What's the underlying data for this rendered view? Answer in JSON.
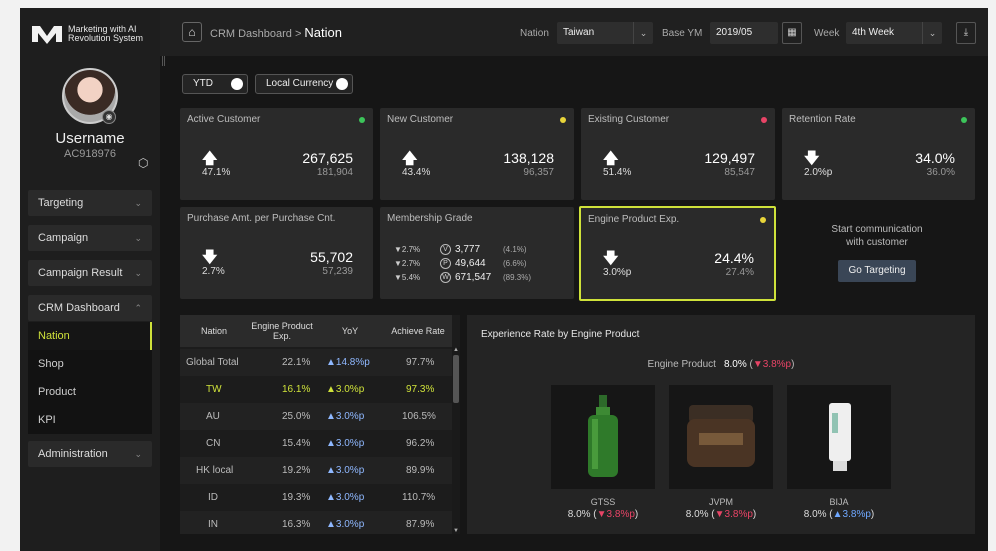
{
  "app": {
    "logo_line1": "Marketing with AI",
    "logo_line2": "Revolution System",
    "logo_mark_text": "MARS"
  },
  "user": {
    "name": "Username",
    "id": "AC918976"
  },
  "sidebar": {
    "menus": [
      {
        "label": "Targeting",
        "chev": "⌄"
      },
      {
        "label": "Campaign",
        "chev": "⌄"
      },
      {
        "label": "Campaign Result",
        "chev": "⌄"
      },
      {
        "label": "CRM Dashboard",
        "chev": "⌃"
      }
    ],
    "submenu": [
      "Nation",
      "Shop",
      "Product",
      "KPI"
    ],
    "admin": {
      "label": "Administration",
      "chev": "⌄"
    }
  },
  "header": {
    "crumb_parent": "CRM Dashboard",
    "crumb_sep": ">",
    "crumb_current": "Nation",
    "nation_label": "Nation",
    "nation_value": "Taiwan",
    "baseym_label": "Base YM",
    "baseym_value": "2019/05",
    "week_label": "Week",
    "week_value": "4th Week",
    "calendar_glyph": "▦",
    "download_glyph": "⤓"
  },
  "toggles": {
    "period": "YTD",
    "currency": "Local Currency"
  },
  "cards": {
    "active": {
      "title": "Active Customer",
      "pct": "47.1%",
      "big": "267,625",
      "sub": "181,904",
      "dot": "#3cc45a",
      "arrow": "🡅"
    },
    "new": {
      "title": "New Customer",
      "pct": "43.4%",
      "big": "138,128",
      "sub": "96,357",
      "dot": "#e8d43a",
      "arrow": "🡅"
    },
    "existing": {
      "title": "Existing Customer",
      "pct": "51.4%",
      "big": "129,497",
      "sub": "85,547",
      "dot": "#e84466",
      "arrow": "🡅"
    },
    "retention": {
      "title": "Retention Rate",
      "pct": "2.0%p",
      "big": "34.0%",
      "sub": "36.0%",
      "dot": "#3cc45a",
      "arrow": "🡇"
    },
    "purchase": {
      "title": "Purchase Amt. per Purchase Cnt.",
      "pct": "2.7%",
      "big": "55,702",
      "sub": "57,239",
      "arrow": "🡇"
    },
    "membership": {
      "title": "Membership Grade",
      "rows": [
        {
          "delta": "▼2.7%",
          "icon": "V",
          "value": "3,777",
          "share": "(4.1%)"
        },
        {
          "delta": "▼2.7%",
          "icon": "P",
          "value": "49,644",
          "share": "(6.6%)"
        },
        {
          "delta": "▼5.4%",
          "icon": "W",
          "value": "671,547",
          "share": "(89.3%)"
        }
      ]
    },
    "engine": {
      "title": "Engine Product Exp.",
      "pct": "3.0%p",
      "big": "24.4%",
      "sub": "27.4%",
      "dot": "#e8d43a",
      "arrow": "🡇"
    }
  },
  "cta": {
    "line1": "Start communication",
    "line2": "with customer",
    "button": "Go Targeting"
  },
  "table": {
    "headers": [
      "Nation",
      "Engine Product Exp.",
      "YoY",
      "Achieve Rate"
    ],
    "rows": [
      {
        "nation": "Global Total",
        "exp": "22.1%",
        "yoy": "▲14.8%p",
        "achieve": "97.7%"
      },
      {
        "nation": "TW",
        "exp": "16.1%",
        "yoy": "▲3.0%p",
        "achieve": "97.3%"
      },
      {
        "nation": "AU",
        "exp": "25.0%",
        "yoy": "▲3.0%p",
        "achieve": "106.5%"
      },
      {
        "nation": "CN",
        "exp": "15.4%",
        "yoy": "▲3.0%p",
        "achieve": "96.2%"
      },
      {
        "nation": "HK local",
        "exp": "19.2%",
        "yoy": "▲3.0%p",
        "achieve": "89.9%"
      },
      {
        "nation": "ID",
        "exp": "19.3%",
        "yoy": "▲3.0%p",
        "achieve": "110.7%"
      },
      {
        "nation": "IN",
        "exp": "16.3%",
        "yoy": "▲3.0%p",
        "achieve": "87.9%"
      }
    ]
  },
  "experience": {
    "title": "Experience Rate by Engine Product",
    "summary_label": "Engine Product",
    "summary_value": "8.0%",
    "summary_delta": "▼3.8%p",
    "products": [
      {
        "name": "GTSS",
        "rate": "8.0%",
        "delta": "▼3.8%p",
        "dir": "down"
      },
      {
        "name": "JVPM",
        "rate": "8.0%",
        "delta": "▼3.8%p",
        "dir": "down"
      },
      {
        "name": "BIJA",
        "rate": "8.0%",
        "delta": "▲3.8%p",
        "dir": "up"
      }
    ]
  }
}
